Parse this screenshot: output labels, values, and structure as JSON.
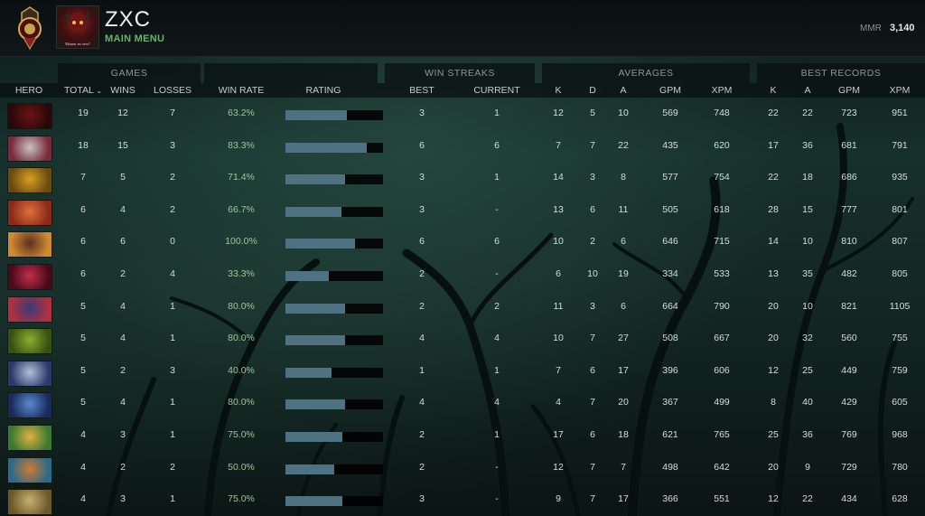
{
  "profile": {
    "username": "ZXC",
    "main_menu": "MAIN MENU",
    "mmr_label": "MMR",
    "mmr_value": "3,140",
    "avatar_caption": "Мужик ты чего?"
  },
  "table": {
    "groups": {
      "games": "GAMES",
      "win_streaks": "WIN STREAKS",
      "averages": "AVERAGES",
      "best_records": "BEST RECORDS"
    },
    "columns": {
      "hero": "HERO",
      "total": "TOTAL",
      "wins": "WINS",
      "losses": "LOSSES",
      "win_rate": "WIN RATE",
      "rating": "RATING",
      "best": "BEST",
      "current": "CURRENT",
      "avg_k": "K",
      "avg_d": "D",
      "avg_a": "A",
      "avg_gpm": "GPM",
      "avg_xpm": "XPM",
      "rec_k": "K",
      "rec_a": "A",
      "rec_gpm": "GPM",
      "rec_xpm": "XPM"
    },
    "sort_icon": "chevron-down-icon",
    "rows": [
      {
        "hero_colors": [
          "#6a1414",
          "#2a0808"
        ],
        "total": "19",
        "wins": "12",
        "losses": "7",
        "win_rate": "63.2%",
        "rating": 0.63,
        "best": "3",
        "current": "1",
        "avg_k": "12",
        "avg_d": "5",
        "avg_a": "10",
        "avg_gpm": "569",
        "avg_xpm": "748",
        "rec_k": "22",
        "rec_a": "22",
        "rec_gpm": "723",
        "rec_xpm": "951"
      },
      {
        "hero_colors": [
          "#c9c3c3",
          "#7a2a3a"
        ],
        "total": "18",
        "wins": "15",
        "losses": "3",
        "win_rate": "83.3%",
        "rating": 0.83,
        "best": "6",
        "current": "6",
        "avg_k": "7",
        "avg_d": "7",
        "avg_a": "22",
        "avg_gpm": "435",
        "avg_xpm": "620",
        "rec_k": "17",
        "rec_a": "36",
        "rec_gpm": "681",
        "rec_xpm": "791"
      },
      {
        "hero_colors": [
          "#d6a020",
          "#6a4a10"
        ],
        "total": "7",
        "wins": "5",
        "losses": "2",
        "win_rate": "71.4%",
        "rating": 0.61,
        "best": "3",
        "current": "1",
        "avg_k": "14",
        "avg_d": "3",
        "avg_a": "8",
        "avg_gpm": "577",
        "avg_xpm": "754",
        "rec_k": "22",
        "rec_a": "18",
        "rec_gpm": "686",
        "rec_xpm": "935"
      },
      {
        "hero_colors": [
          "#e0703a",
          "#8a2a1a"
        ],
        "total": "6",
        "wins": "4",
        "losses": "2",
        "win_rate": "66.7%",
        "rating": 0.57,
        "best": "3",
        "current": "-",
        "avg_k": "13",
        "avg_d": "6",
        "avg_a": "11",
        "avg_gpm": "505",
        "avg_xpm": "618",
        "rec_k": "28",
        "rec_a": "15",
        "rec_gpm": "777",
        "rec_xpm": "801"
      },
      {
        "hero_colors": [
          "#5a3020",
          "#d08a30"
        ],
        "total": "6",
        "wins": "6",
        "losses": "0",
        "win_rate": "100.0%",
        "rating": 0.71,
        "best": "6",
        "current": "6",
        "avg_k": "10",
        "avg_d": "2",
        "avg_a": "6",
        "avg_gpm": "646",
        "avg_xpm": "715",
        "rec_k": "14",
        "rec_a": "10",
        "rec_gpm": "810",
        "rec_xpm": "807"
      },
      {
        "hero_colors": [
          "#c0304a",
          "#4a0a1a"
        ],
        "total": "6",
        "wins": "2",
        "losses": "4",
        "win_rate": "33.3%",
        "rating": 0.44,
        "best": "2",
        "current": "-",
        "avg_k": "6",
        "avg_d": "10",
        "avg_a": "19",
        "avg_gpm": "334",
        "avg_xpm": "533",
        "rec_k": "13",
        "rec_a": "35",
        "rec_gpm": "482",
        "rec_xpm": "805"
      },
      {
        "hero_colors": [
          "#3a3a7a",
          "#b03040"
        ],
        "total": "5",
        "wins": "4",
        "losses": "1",
        "win_rate": "80.0%",
        "rating": 0.61,
        "best": "2",
        "current": "2",
        "avg_k": "11",
        "avg_d": "3",
        "avg_a": "6",
        "avg_gpm": "664",
        "avg_xpm": "790",
        "rec_k": "20",
        "rec_a": "10",
        "rec_gpm": "821",
        "rec_xpm": "1105"
      },
      {
        "hero_colors": [
          "#8ab030",
          "#3a5010"
        ],
        "total": "5",
        "wins": "4",
        "losses": "1",
        "win_rate": "80.0%",
        "rating": 0.61,
        "best": "4",
        "current": "4",
        "avg_k": "10",
        "avg_d": "7",
        "avg_a": "27",
        "avg_gpm": "508",
        "avg_xpm": "667",
        "rec_k": "20",
        "rec_a": "32",
        "rec_gpm": "560",
        "rec_xpm": "755"
      },
      {
        "hero_colors": [
          "#b0c0d8",
          "#2a3a6a"
        ],
        "total": "5",
        "wins": "2",
        "losses": "3",
        "win_rate": "40.0%",
        "rating": 0.47,
        "best": "1",
        "current": "1",
        "avg_k": "7",
        "avg_d": "6",
        "avg_a": "17",
        "avg_gpm": "396",
        "avg_xpm": "606",
        "rec_k": "12",
        "rec_a": "25",
        "rec_gpm": "449",
        "rec_xpm": "759"
      },
      {
        "hero_colors": [
          "#5a8ad0",
          "#1a2a5a"
        ],
        "total": "5",
        "wins": "4",
        "losses": "1",
        "win_rate": "80.0%",
        "rating": 0.61,
        "best": "4",
        "current": "4",
        "avg_k": "4",
        "avg_d": "7",
        "avg_a": "20",
        "avg_gpm": "367",
        "avg_xpm": "499",
        "rec_k": "8",
        "rec_a": "40",
        "rec_gpm": "429",
        "rec_xpm": "605"
      },
      {
        "hero_colors": [
          "#e0b040",
          "#3a7a30"
        ],
        "total": "4",
        "wins": "3",
        "losses": "1",
        "win_rate": "75.0%",
        "rating": 0.58,
        "best": "2",
        "current": "1",
        "avg_k": "17",
        "avg_d": "6",
        "avg_a": "18",
        "avg_gpm": "621",
        "avg_xpm": "765",
        "rec_k": "25",
        "rec_a": "36",
        "rec_gpm": "769",
        "rec_xpm": "968"
      },
      {
        "hero_colors": [
          "#d07a30",
          "#2a6a8a"
        ],
        "total": "4",
        "wins": "2",
        "losses": "2",
        "win_rate": "50.0%",
        "rating": 0.5,
        "best": "2",
        "current": "-",
        "avg_k": "12",
        "avg_d": "7",
        "avg_a": "7",
        "avg_gpm": "498",
        "avg_xpm": "642",
        "rec_k": "20",
        "rec_a": "9",
        "rec_gpm": "729",
        "rec_xpm": "780"
      },
      {
        "hero_colors": [
          "#c8b070",
          "#6a5a2a"
        ],
        "total": "4",
        "wins": "3",
        "losses": "1",
        "win_rate": "75.0%",
        "rating": 0.58,
        "best": "3",
        "current": "-",
        "avg_k": "9",
        "avg_d": "7",
        "avg_a": "17",
        "avg_gpm": "366",
        "avg_xpm": "551",
        "rec_k": "12",
        "rec_a": "22",
        "rec_gpm": "434",
        "rec_xpm": "628"
      }
    ]
  }
}
